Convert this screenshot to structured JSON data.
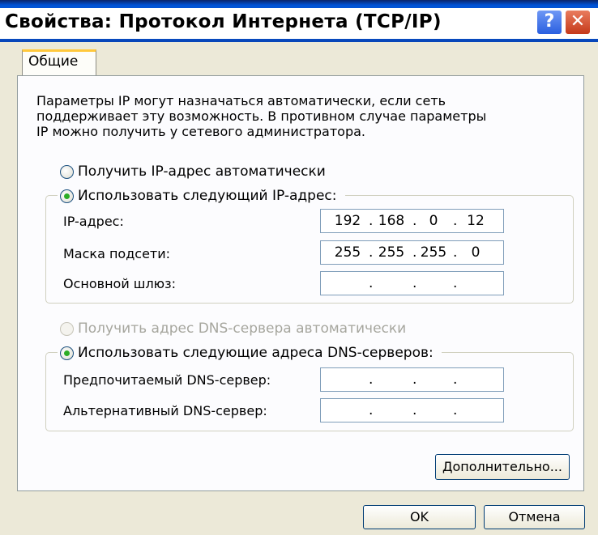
{
  "window": {
    "title": "Свойства: Протокол Интернета (TCP/IP)",
    "help_label": "?",
    "close_label": "✕"
  },
  "tabs": [
    {
      "label": "Общие",
      "active": true
    }
  ],
  "description": {
    "lines": [
      "Параметры IP могут назначаться автоматически, если сеть",
      "поддерживает эту возможность. В противном случае параметры",
      "IP можно получить у сетевого администратора."
    ]
  },
  "ip_section": {
    "auto_option": {
      "label": "Получить IP-адрес автоматически",
      "checked": false
    },
    "manual_option": {
      "label": "Использовать следующий IP-адрес:",
      "checked": true
    },
    "fields": [
      {
        "label": "IP-адрес:",
        "octets": [
          "192",
          "168",
          "0",
          "12"
        ]
      },
      {
        "label": "Маска подсети:",
        "octets": [
          "255",
          "255",
          "255",
          "0"
        ]
      },
      {
        "label": "Основной шлюз:",
        "octets": [
          "",
          "",
          "",
          ""
        ]
      }
    ]
  },
  "dns_section": {
    "auto_option": {
      "label": "Получить адрес DNS-сервера автоматически",
      "checked": false,
      "enabled": false
    },
    "manual_option": {
      "label": "Использовать следующие адреса DNS-серверов:",
      "checked": true
    },
    "fields": [
      {
        "label": "Предпочитаемый DNS-сервер:",
        "octets": [
          "",
          "",
          "",
          ""
        ]
      },
      {
        "label": "Альтернативный DNS-сервер:",
        "octets": [
          "",
          "",
          "",
          ""
        ]
      }
    ]
  },
  "buttons": {
    "advanced": "Дополнительно...",
    "ok": "OK",
    "cancel": "Отмена"
  },
  "colors": {
    "titlebar": "#0a5fe0",
    "tab_highlight": "#ffc83c",
    "radio_dot": "#2cad24",
    "dialog_bg": "#ece9d8"
  }
}
